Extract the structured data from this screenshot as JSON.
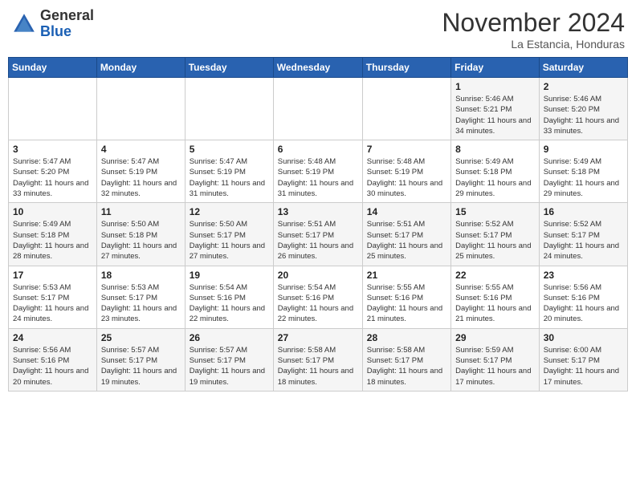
{
  "header": {
    "logo_line1": "General",
    "logo_line2": "Blue",
    "month": "November 2024",
    "location": "La Estancia, Honduras"
  },
  "weekdays": [
    "Sunday",
    "Monday",
    "Tuesday",
    "Wednesday",
    "Thursday",
    "Friday",
    "Saturday"
  ],
  "weeks": [
    [
      {
        "day": "",
        "sunrise": "",
        "sunset": "",
        "daylight": ""
      },
      {
        "day": "",
        "sunrise": "",
        "sunset": "",
        "daylight": ""
      },
      {
        "day": "",
        "sunrise": "",
        "sunset": "",
        "daylight": ""
      },
      {
        "day": "",
        "sunrise": "",
        "sunset": "",
        "daylight": ""
      },
      {
        "day": "",
        "sunrise": "",
        "sunset": "",
        "daylight": ""
      },
      {
        "day": "1",
        "sunrise": "Sunrise: 5:46 AM",
        "sunset": "Sunset: 5:21 PM",
        "daylight": "Daylight: 11 hours and 34 minutes."
      },
      {
        "day": "2",
        "sunrise": "Sunrise: 5:46 AM",
        "sunset": "Sunset: 5:20 PM",
        "daylight": "Daylight: 11 hours and 33 minutes."
      }
    ],
    [
      {
        "day": "3",
        "sunrise": "Sunrise: 5:47 AM",
        "sunset": "Sunset: 5:20 PM",
        "daylight": "Daylight: 11 hours and 33 minutes."
      },
      {
        "day": "4",
        "sunrise": "Sunrise: 5:47 AM",
        "sunset": "Sunset: 5:19 PM",
        "daylight": "Daylight: 11 hours and 32 minutes."
      },
      {
        "day": "5",
        "sunrise": "Sunrise: 5:47 AM",
        "sunset": "Sunset: 5:19 PM",
        "daylight": "Daylight: 11 hours and 31 minutes."
      },
      {
        "day": "6",
        "sunrise": "Sunrise: 5:48 AM",
        "sunset": "Sunset: 5:19 PM",
        "daylight": "Daylight: 11 hours and 31 minutes."
      },
      {
        "day": "7",
        "sunrise": "Sunrise: 5:48 AM",
        "sunset": "Sunset: 5:19 PM",
        "daylight": "Daylight: 11 hours and 30 minutes."
      },
      {
        "day": "8",
        "sunrise": "Sunrise: 5:49 AM",
        "sunset": "Sunset: 5:18 PM",
        "daylight": "Daylight: 11 hours and 29 minutes."
      },
      {
        "day": "9",
        "sunrise": "Sunrise: 5:49 AM",
        "sunset": "Sunset: 5:18 PM",
        "daylight": "Daylight: 11 hours and 29 minutes."
      }
    ],
    [
      {
        "day": "10",
        "sunrise": "Sunrise: 5:49 AM",
        "sunset": "Sunset: 5:18 PM",
        "daylight": "Daylight: 11 hours and 28 minutes."
      },
      {
        "day": "11",
        "sunrise": "Sunrise: 5:50 AM",
        "sunset": "Sunset: 5:18 PM",
        "daylight": "Daylight: 11 hours and 27 minutes."
      },
      {
        "day": "12",
        "sunrise": "Sunrise: 5:50 AM",
        "sunset": "Sunset: 5:17 PM",
        "daylight": "Daylight: 11 hours and 27 minutes."
      },
      {
        "day": "13",
        "sunrise": "Sunrise: 5:51 AM",
        "sunset": "Sunset: 5:17 PM",
        "daylight": "Daylight: 11 hours and 26 minutes."
      },
      {
        "day": "14",
        "sunrise": "Sunrise: 5:51 AM",
        "sunset": "Sunset: 5:17 PM",
        "daylight": "Daylight: 11 hours and 25 minutes."
      },
      {
        "day": "15",
        "sunrise": "Sunrise: 5:52 AM",
        "sunset": "Sunset: 5:17 PM",
        "daylight": "Daylight: 11 hours and 25 minutes."
      },
      {
        "day": "16",
        "sunrise": "Sunrise: 5:52 AM",
        "sunset": "Sunset: 5:17 PM",
        "daylight": "Daylight: 11 hours and 24 minutes."
      }
    ],
    [
      {
        "day": "17",
        "sunrise": "Sunrise: 5:53 AM",
        "sunset": "Sunset: 5:17 PM",
        "daylight": "Daylight: 11 hours and 24 minutes."
      },
      {
        "day": "18",
        "sunrise": "Sunrise: 5:53 AM",
        "sunset": "Sunset: 5:17 PM",
        "daylight": "Daylight: 11 hours and 23 minutes."
      },
      {
        "day": "19",
        "sunrise": "Sunrise: 5:54 AM",
        "sunset": "Sunset: 5:16 PM",
        "daylight": "Daylight: 11 hours and 22 minutes."
      },
      {
        "day": "20",
        "sunrise": "Sunrise: 5:54 AM",
        "sunset": "Sunset: 5:16 PM",
        "daylight": "Daylight: 11 hours and 22 minutes."
      },
      {
        "day": "21",
        "sunrise": "Sunrise: 5:55 AM",
        "sunset": "Sunset: 5:16 PM",
        "daylight": "Daylight: 11 hours and 21 minutes."
      },
      {
        "day": "22",
        "sunrise": "Sunrise: 5:55 AM",
        "sunset": "Sunset: 5:16 PM",
        "daylight": "Daylight: 11 hours and 21 minutes."
      },
      {
        "day": "23",
        "sunrise": "Sunrise: 5:56 AM",
        "sunset": "Sunset: 5:16 PM",
        "daylight": "Daylight: 11 hours and 20 minutes."
      }
    ],
    [
      {
        "day": "24",
        "sunrise": "Sunrise: 5:56 AM",
        "sunset": "Sunset: 5:16 PM",
        "daylight": "Daylight: 11 hours and 20 minutes."
      },
      {
        "day": "25",
        "sunrise": "Sunrise: 5:57 AM",
        "sunset": "Sunset: 5:17 PM",
        "daylight": "Daylight: 11 hours and 19 minutes."
      },
      {
        "day": "26",
        "sunrise": "Sunrise: 5:57 AM",
        "sunset": "Sunset: 5:17 PM",
        "daylight": "Daylight: 11 hours and 19 minutes."
      },
      {
        "day": "27",
        "sunrise": "Sunrise: 5:58 AM",
        "sunset": "Sunset: 5:17 PM",
        "daylight": "Daylight: 11 hours and 18 minutes."
      },
      {
        "day": "28",
        "sunrise": "Sunrise: 5:58 AM",
        "sunset": "Sunset: 5:17 PM",
        "daylight": "Daylight: 11 hours and 18 minutes."
      },
      {
        "day": "29",
        "sunrise": "Sunrise: 5:59 AM",
        "sunset": "Sunset: 5:17 PM",
        "daylight": "Daylight: 11 hours and 17 minutes."
      },
      {
        "day": "30",
        "sunrise": "Sunrise: 6:00 AM",
        "sunset": "Sunset: 5:17 PM",
        "daylight": "Daylight: 11 hours and 17 minutes."
      }
    ]
  ]
}
